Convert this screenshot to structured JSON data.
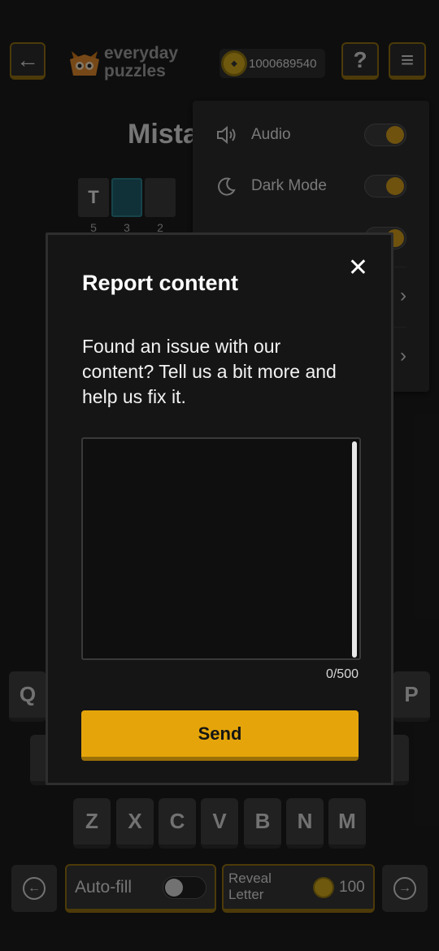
{
  "header": {
    "back_icon": "←",
    "logo_line1": "everyday",
    "logo_line2": "puzzles",
    "coin_balance": "1000689540",
    "help_icon": "?",
    "menu_icon": "≡"
  },
  "puzzle": {
    "title": "Mista",
    "tiles": [
      "T",
      "",
      ""
    ],
    "numbers": [
      "5",
      "3",
      "2"
    ]
  },
  "settings_menu": {
    "items": [
      {
        "label": "Audio",
        "icon": "speaker-icon",
        "toggle": true
      },
      {
        "label": "Dark Mode",
        "icon": "moon-icon",
        "toggle": true
      }
    ]
  },
  "keyboard": {
    "row1_left": "Q",
    "row1_right": "P",
    "row3": [
      "Z",
      "X",
      "C",
      "V",
      "B",
      "N",
      "M"
    ]
  },
  "bottom_bar": {
    "prev_icon": "←",
    "autofill_label": "Auto-fill",
    "reveal_label": "Reveal Letter",
    "reveal_cost": "100",
    "next_icon": "→"
  },
  "modal": {
    "title": "Report content",
    "description": "Found an issue with our content? Tell us a bit more and help us fix it.",
    "textarea_value": "",
    "counter": "0/500",
    "send_label": "Send",
    "close_icon": "✕"
  },
  "colors": {
    "accent": "#e5a50a",
    "background": "#1b1b1b",
    "modal_bg": "#151515"
  }
}
